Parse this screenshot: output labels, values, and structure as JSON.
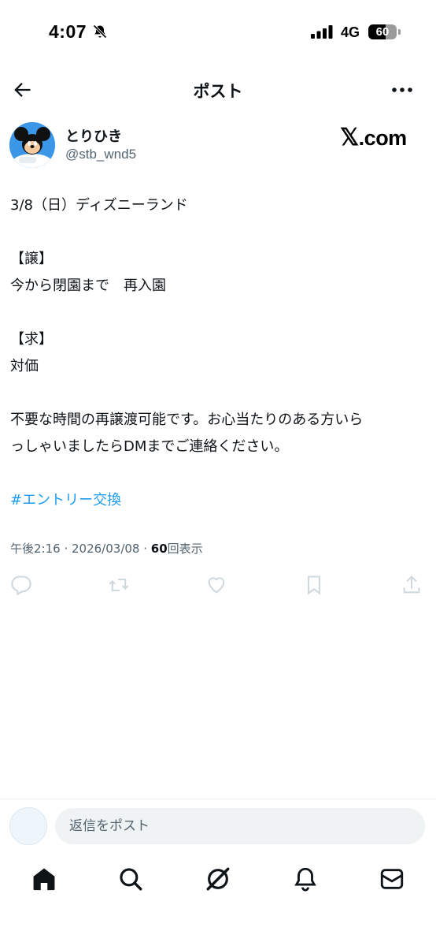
{
  "status_bar": {
    "time": "4:07",
    "network": "4G",
    "battery_percent": 60,
    "battery_label": "60",
    "icons": [
      "bell-slash-icon",
      "signal-icon",
      "battery-icon"
    ]
  },
  "nav": {
    "title": "ポスト",
    "icons": [
      "back-arrow-icon",
      "more-icon"
    ]
  },
  "author": {
    "display_name": "とりひき",
    "handle": "@stb_wnd5",
    "brand_x": "𝕏",
    "brand_rest": ".com"
  },
  "post": {
    "line1": "3/8（日）ディズニーランド",
    "give_label": "【譲】",
    "give_text": "今から閉園まで　再入園",
    "want_label": "【求】",
    "want_text": "対価",
    "note_line1": "不要な時間の再譲渡可能です。お心当たりのある方いら",
    "note_line2": "っしゃいましたらDMまでご連絡ください。",
    "hashtag": "#エントリー交換"
  },
  "meta": {
    "time": "午後2:16",
    "separator": " · ",
    "date": "2026/03/08",
    "views_count": "60",
    "views_label": "回表示"
  },
  "actions": {
    "icons": [
      "reply-icon",
      "repost-icon",
      "like-icon",
      "bookmark-icon",
      "share-icon"
    ]
  },
  "reply": {
    "placeholder": "返信をポスト"
  },
  "tab_bar": {
    "icons": [
      "home-icon",
      "search-icon",
      "grok-icon",
      "notifications-icon",
      "messages-icon"
    ]
  },
  "colors": {
    "text": "#0f1419",
    "secondary": "#536471",
    "accent": "#1d9bf0",
    "action_icon": "#cfd9de"
  }
}
